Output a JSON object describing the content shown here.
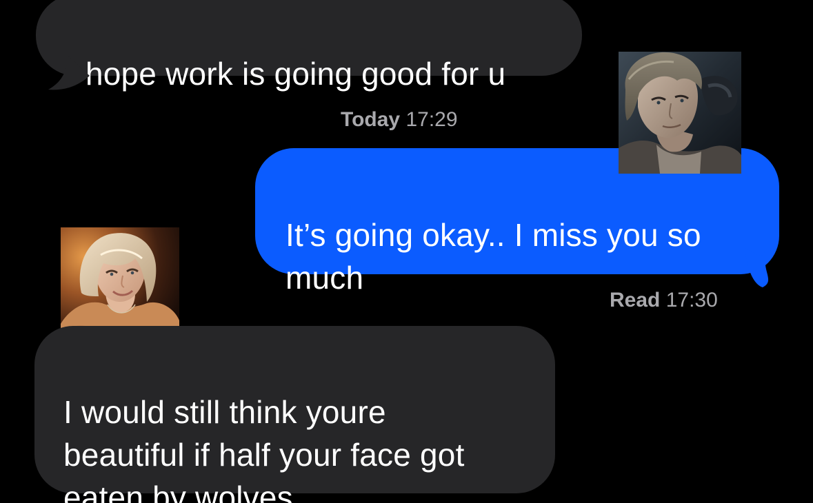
{
  "conversation": {
    "messages": [
      {
        "direction": "incoming",
        "text": "I hope work is going good for u"
      },
      {
        "direction": "outgoing",
        "text": "It’s going okay.. I miss you so\nmuch"
      },
      {
        "direction": "incoming",
        "text": "I would still think youre\nbeautiful if half your face got\neaten by wolves"
      }
    ],
    "timestamp_today": {
      "day": "Today",
      "time": "17:29"
    },
    "read_receipt": {
      "status": "Read",
      "time": "17:30"
    }
  },
  "colors": {
    "background": "#000000",
    "incoming_bubble": "#262628",
    "outgoing_bubble": "#0b5cff",
    "timestamp_text": "#a9a9ad"
  },
  "icons": {
    "sticker_top_right": "avatar-sticker-man-icon",
    "sticker_left": "avatar-sticker-woman-icon"
  }
}
